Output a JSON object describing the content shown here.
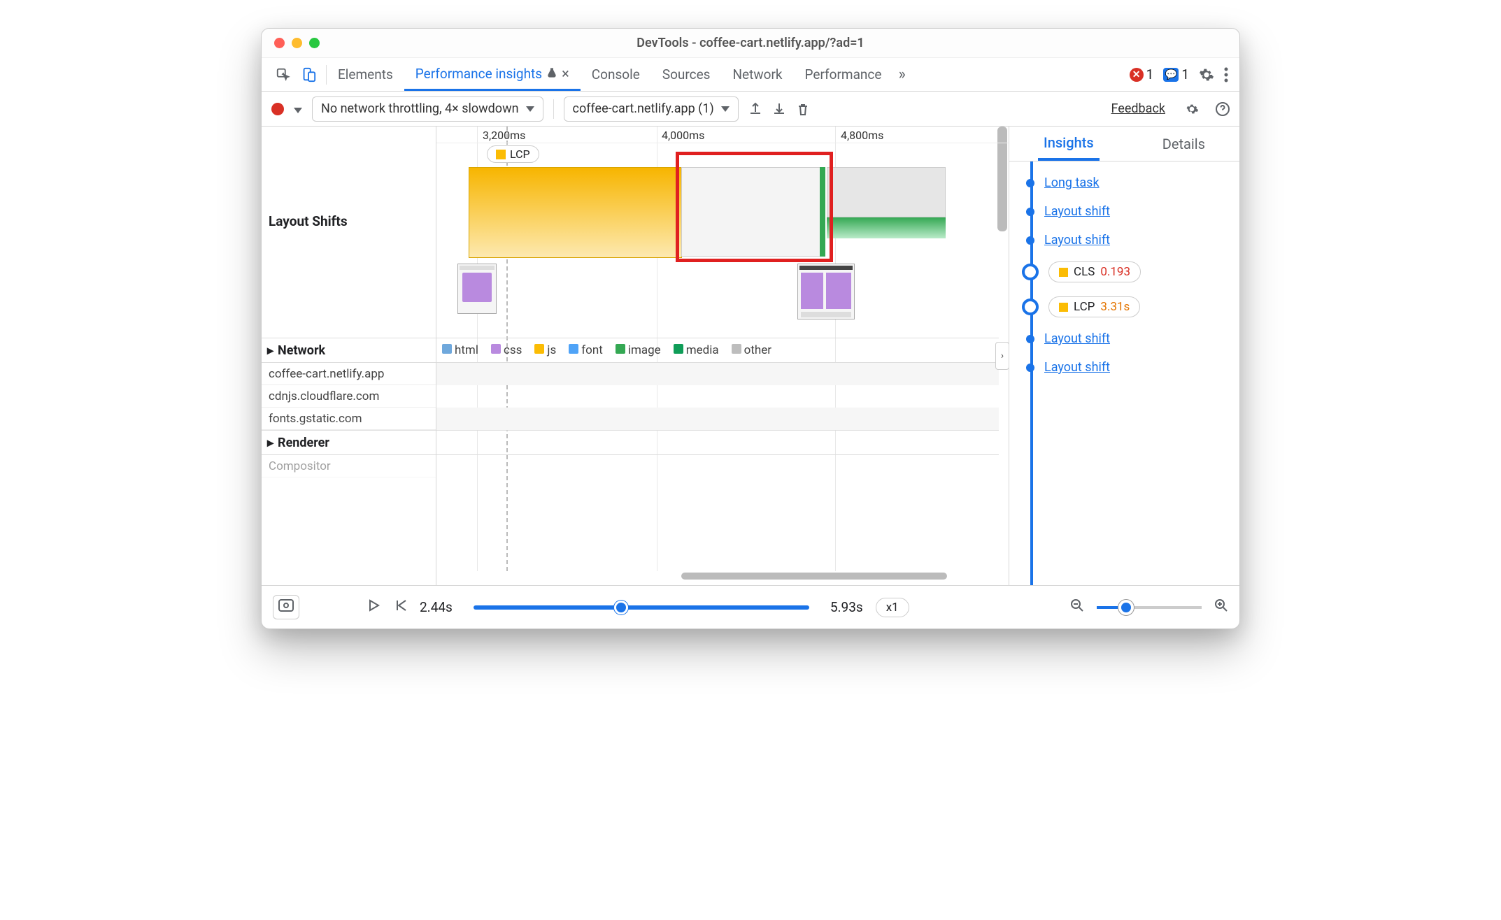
{
  "window_title": "DevTools - coffee-cart.netlify.app/?ad=1",
  "tabs": {
    "elements": "Elements",
    "perf_insights": "Performance insights",
    "console": "Console",
    "sources": "Sources",
    "network": "Network",
    "performance": "Performance"
  },
  "errors_count": "1",
  "messages_count": "1",
  "toolbar": {
    "throttle": "No network throttling, 4× slowdown",
    "recording_select": "coffee-cart.netlify.app (1)",
    "feedback": "Feedback"
  },
  "timeline": {
    "ticks": {
      "t1": "3,200ms",
      "t2": "4,000ms",
      "t3": "4,800ms"
    },
    "lcp_badge": "LCP",
    "layout_shifts_label": "Layout Shifts",
    "network_label": "Network",
    "renderer_label": "Renderer",
    "compositor_label": "Compositor",
    "legend": {
      "html": "html",
      "css": "css",
      "js": "js",
      "font": "font",
      "image": "image",
      "media": "media",
      "other": "other"
    },
    "hosts": {
      "h1": "coffee-cart.netlify.app",
      "h2": "cdnjs.cloudflare.com",
      "h3": "fonts.gstatic.com"
    }
  },
  "right": {
    "tab_insights": "Insights",
    "tab_details": "Details",
    "items": {
      "long_task": "Long task",
      "layout_shift": "Layout shift",
      "cls_label": "CLS",
      "cls_value": "0.193",
      "lcp_label": "LCP",
      "lcp_value": "3.31s"
    }
  },
  "bottom": {
    "t_start": "2.44s",
    "t_end": "5.93s",
    "speed": "x1"
  },
  "colors": {
    "html": "#6fa8dc",
    "css": "#b98adf",
    "js": "#fbbc04",
    "font": "#4fa3f7",
    "image": "#34a853",
    "media": "#0f9d58",
    "other": "#bdbdbd",
    "orange": "#fbbc04",
    "green": "#34a853",
    "blue": "#1a73e8",
    "red": "#d93025"
  }
}
